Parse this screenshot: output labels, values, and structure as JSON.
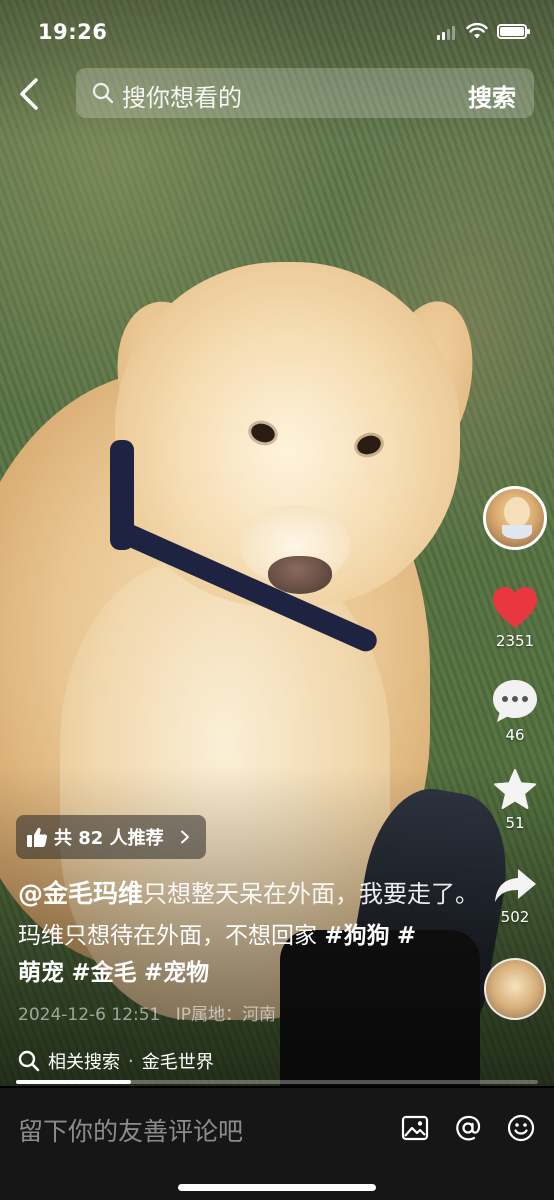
{
  "status_bar": {
    "time": "19:26"
  },
  "search": {
    "placeholder": "搜你想看的",
    "button_label": "搜索"
  },
  "actions": {
    "likes": "2351",
    "comments": "46",
    "favorites": "51",
    "shares": "502",
    "like_color": "#e8373f"
  },
  "recommend": {
    "text": "共 82 人推荐"
  },
  "post": {
    "author": "@金毛玛维",
    "title": "只想整天呆在外面，我要走了。",
    "desc_prefix": "玛维只想待在外面，不想回家",
    "hashtags": [
      "#狗狗",
      "#萌宠",
      "#金毛",
      "#宠物"
    ],
    "date": "2024-12-6 12:51",
    "ip_location": "IP属地：河南"
  },
  "related": {
    "label": "相关搜索",
    "separator": "·",
    "term": "金毛世界"
  },
  "progress": {
    "fraction": 0.22
  },
  "comment_bar": {
    "placeholder": "留下你的友善评论吧"
  }
}
